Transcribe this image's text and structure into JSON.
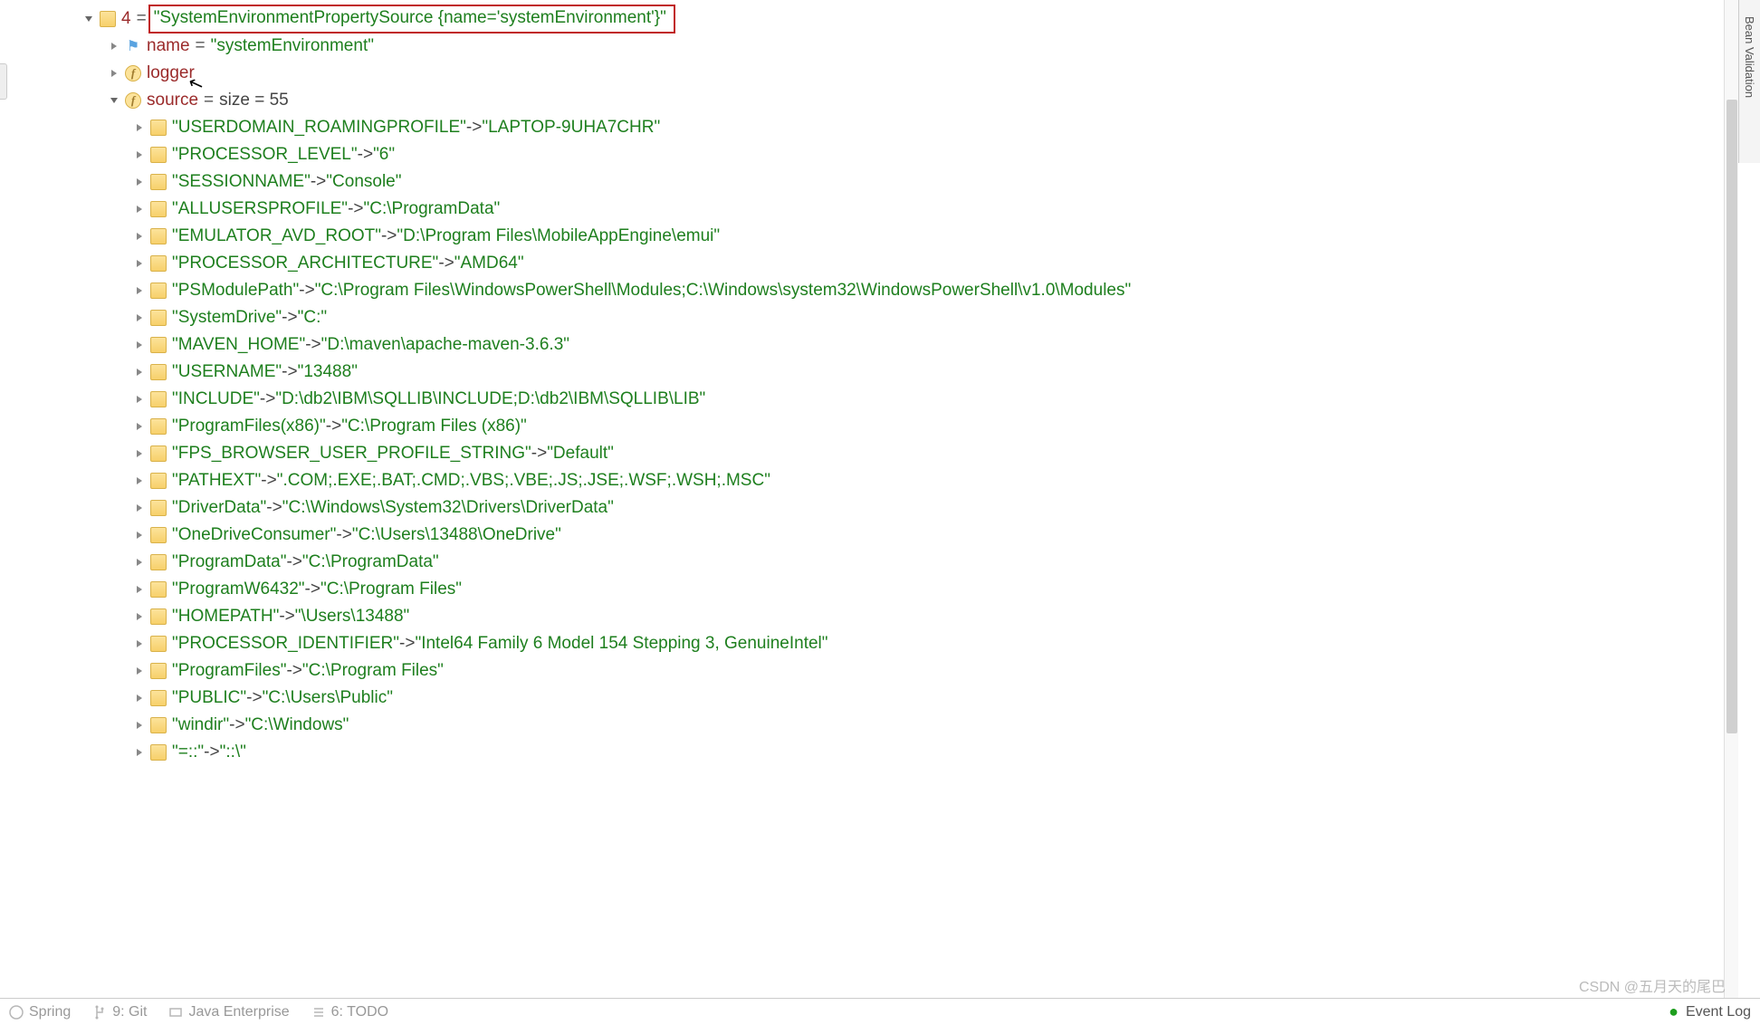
{
  "root": {
    "index": "4",
    "eq": " = ",
    "label": "\"SystemEnvironmentPropertySource {name='systemEnvironment'}\""
  },
  "children": {
    "name": {
      "label": "name",
      "eq": " = ",
      "value": "\"systemEnvironment\""
    },
    "logger": {
      "label": "logger"
    },
    "source": {
      "label": "source",
      "eq": " = ",
      "size_label": " size = 55"
    }
  },
  "entries": [
    {
      "key": "\"USERDOMAIN_ROAMINGPROFILE\"",
      "arrow": " -> ",
      "value": "\"LAPTOP-9UHA7CHR\""
    },
    {
      "key": "\"PROCESSOR_LEVEL\"",
      "arrow": " -> ",
      "value": "\"6\""
    },
    {
      "key": "\"SESSIONNAME\"",
      "arrow": " -> ",
      "value": "\"Console\""
    },
    {
      "key": "\"ALLUSERSPROFILE\"",
      "arrow": " -> ",
      "value": "\"C:\\ProgramData\""
    },
    {
      "key": "\"EMULATOR_AVD_ROOT\"",
      "arrow": " -> ",
      "value": "\"D:\\Program Files\\MobileAppEngine\\emui\""
    },
    {
      "key": "\"PROCESSOR_ARCHITECTURE\"",
      "arrow": " -> ",
      "value": "\"AMD64\""
    },
    {
      "key": "\"PSModulePath\"",
      "arrow": " -> ",
      "value": "\"C:\\Program Files\\WindowsPowerShell\\Modules;C:\\Windows\\system32\\WindowsPowerShell\\v1.0\\Modules\""
    },
    {
      "key": "\"SystemDrive\"",
      "arrow": " -> ",
      "value": "\"C:\""
    },
    {
      "key": "\"MAVEN_HOME\"",
      "arrow": " -> ",
      "value": "\"D:\\maven\\apache-maven-3.6.3\""
    },
    {
      "key": "\"USERNAME\"",
      "arrow": " -> ",
      "value": "\"13488\""
    },
    {
      "key": "\"INCLUDE\"",
      "arrow": " -> ",
      "value": "\"D:\\db2\\IBM\\SQLLIB\\INCLUDE;D:\\db2\\IBM\\SQLLIB\\LIB\""
    },
    {
      "key": "\"ProgramFiles(x86)\"",
      "arrow": " -> ",
      "value": "\"C:\\Program Files (x86)\""
    },
    {
      "key": "\"FPS_BROWSER_USER_PROFILE_STRING\"",
      "arrow": " -> ",
      "value": "\"Default\""
    },
    {
      "key": "\"PATHEXT\"",
      "arrow": " -> ",
      "value": "\".COM;.EXE;.BAT;.CMD;.VBS;.VBE;.JS;.JSE;.WSF;.WSH;.MSC\""
    },
    {
      "key": "\"DriverData\"",
      "arrow": " -> ",
      "value": "\"C:\\Windows\\System32\\Drivers\\DriverData\""
    },
    {
      "key": "\"OneDriveConsumer\"",
      "arrow": " -> ",
      "value": "\"C:\\Users\\13488\\OneDrive\""
    },
    {
      "key": "\"ProgramData\"",
      "arrow": " -> ",
      "value": "\"C:\\ProgramData\""
    },
    {
      "key": "\"ProgramW6432\"",
      "arrow": " -> ",
      "value": "\"C:\\Program Files\""
    },
    {
      "key": "\"HOMEPATH\"",
      "arrow": " -> ",
      "value": "\"\\Users\\13488\""
    },
    {
      "key": "\"PROCESSOR_IDENTIFIER\"",
      "arrow": " -> ",
      "value": "\"Intel64 Family 6 Model 154 Stepping 3, GenuineIntel\""
    },
    {
      "key": "\"ProgramFiles\"",
      "arrow": " -> ",
      "value": "\"C:\\Program Files\""
    },
    {
      "key": "\"PUBLIC\"",
      "arrow": " -> ",
      "value": "\"C:\\Users\\Public\""
    },
    {
      "key": "\"windir\"",
      "arrow": " -> ",
      "value": "\"C:\\Windows\""
    },
    {
      "key": "\"=::\"",
      "arrow": " -> ",
      "value": "\"::\\\""
    }
  ],
  "bottom": {
    "spring": "Spring",
    "git": "9: Git",
    "java_ee": "Java Enterprise",
    "todo": "6: TODO",
    "event_log": "Event Log"
  },
  "sidebar": {
    "label": "Bean Validation"
  },
  "watermark": "CSDN @五月天的尾巴"
}
